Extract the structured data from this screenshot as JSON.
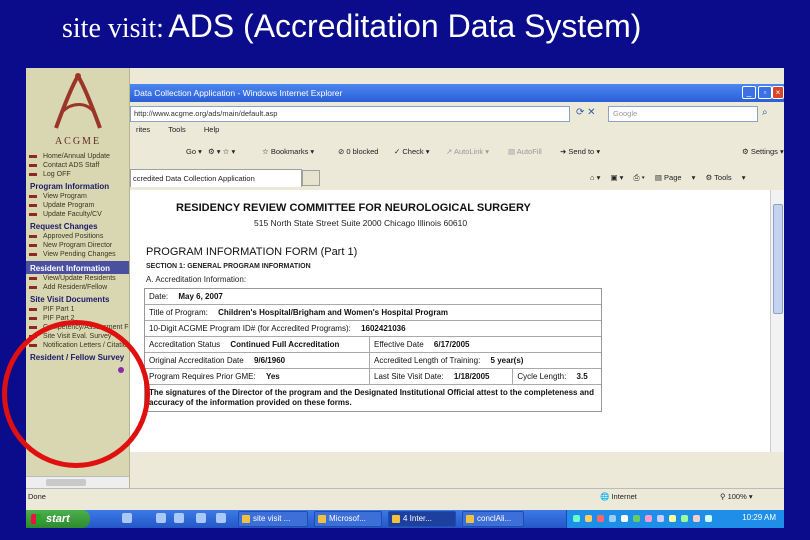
{
  "slide": {
    "title_prefix": "site visit:",
    "title_main": "ADS (Accreditation Data System)"
  },
  "sidebar": {
    "brand": "ACGME",
    "top_links": [
      "Home/Annual Update",
      "Contact ADS Staff",
      "Log OFF"
    ],
    "sections": [
      {
        "title": "Program Information",
        "links": [
          "View Program",
          "Update Program",
          "Update Faculty/CV"
        ]
      },
      {
        "title": "Request Changes",
        "links": [
          "Approved Positions",
          "New Program Director",
          "View Pending Changes"
        ]
      },
      {
        "title": "Resident Information",
        "links": [
          "View/Update Residents",
          "Add Resident/Fellow"
        ]
      },
      {
        "title": "Site Visit Documents",
        "links": [
          "PIF Part 1",
          "PIF Part 2",
          "Competency/Assessment Form",
          "Site Visit Eval. Survey",
          "Notification Letters / Citations"
        ]
      },
      {
        "title": "Resident / Fellow Survey",
        "links": []
      }
    ]
  },
  "browser": {
    "title": "Data Collection Application - Windows Internet Explorer",
    "url": "http://www.acgme.org/ads/main/default.asp",
    "search_placeholder": "Google",
    "menu": [
      "rites",
      "Tools",
      "Help"
    ],
    "toolbar": {
      "go": "Go",
      "bookmarks": "Bookmarks",
      "blocked": "0 blocked",
      "check": "Check",
      "autolink": "AutoLink",
      "autofill": "AutoFill",
      "send_to": "Send to",
      "settings": "Settings"
    },
    "tab_label": "ccredited Data Collection Application",
    "tab_tools": {
      "page": "Page",
      "tools": "Tools"
    },
    "status": {
      "left": "Done",
      "zone": "Internet",
      "zoom": "100%"
    }
  },
  "page": {
    "heading": "RESIDENCY REVIEW COMMITTEE FOR NEUROLOGICAL SURGERY",
    "address": "515 North State Street Suite 2000 Chicago Illinois 60610",
    "form_title": "PROGRAM INFORMATION FORM (Part 1)",
    "section_title": "SECTION 1: GENERAL PROGRAM INFORMATION",
    "subsection": "A. Accreditation Information:",
    "date_label": "Date:",
    "date_value": "May 6, 2007",
    "program_title_label": "Title of Program:",
    "program_title_value": "Children's Hospital/Brigham and Women's Hospital Program",
    "program_id_label": "10-Digit ACGME Program ID# (for Accredited Programs):",
    "program_id_value": "1602421036",
    "accred_status_label": "Accreditation Status",
    "accred_status_value": "Continued Full Accreditation",
    "effective_date_label": "Effective Date",
    "effective_date_value": "6/17/2005",
    "orig_accred_label": "Original Accreditation Date",
    "orig_accred_value": "9/6/1960",
    "training_length_label": "Accredited Length of Training:",
    "training_length_value": "5 year(s)",
    "gme_label": "Program Requires Prior GME:",
    "gme_value": "Yes",
    "last_visit_label": "Last Site Visit Date:",
    "last_visit_value": "1/18/2005",
    "cycle_label": "Cycle Length:",
    "cycle_value": "3.5",
    "note": "The signatures of the Director of the program and the Designated Institutional Official attest to the completeness and accuracy of the information provided on these forms."
  },
  "taskbar": {
    "start": "start",
    "buttons": [
      "site visit ...",
      "Microsof...",
      "4 Inter...",
      "conclAli..."
    ],
    "clock": "10:29 AM"
  }
}
